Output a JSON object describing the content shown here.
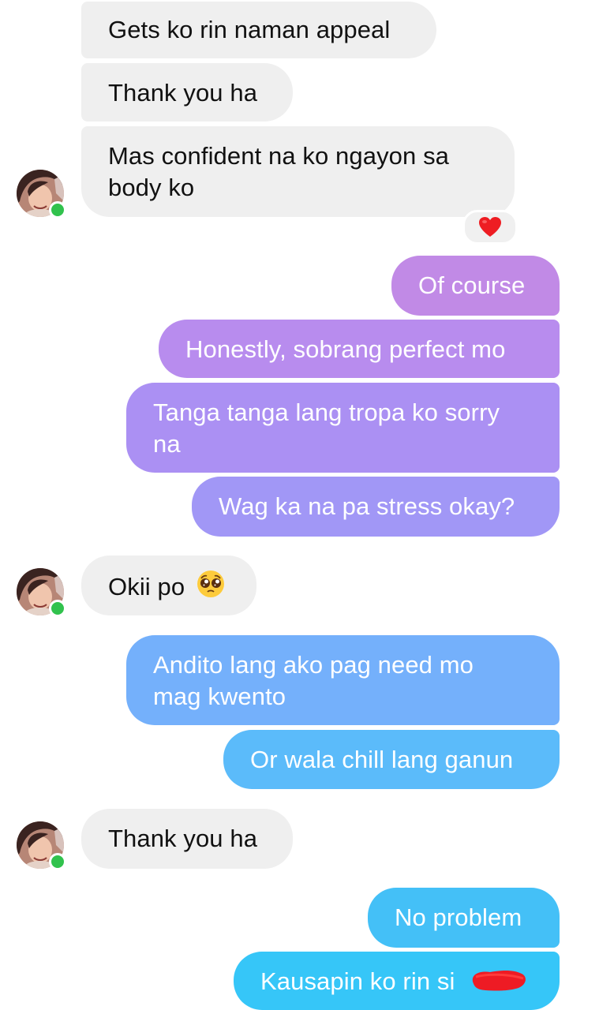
{
  "chat": {
    "messages": [
      {
        "from": "contact",
        "text": "Gets ko rin naman appeal"
      },
      {
        "from": "contact",
        "text": "Thank you ha"
      },
      {
        "from": "contact",
        "text": "Mas confident na ko ngayon sa body ko",
        "line1": "Mas confident na ko ngayon sa",
        "line2": "body ko",
        "reaction": "red-heart"
      },
      {
        "from": "me",
        "text": "Of course"
      },
      {
        "from": "me",
        "text": "Honestly, sobrang perfect mo"
      },
      {
        "from": "me",
        "text": "Tanga tanga lang tropa ko sorry na",
        "line1": "Tanga tanga lang tropa ko sorry",
        "line2": "na"
      },
      {
        "from": "me",
        "text": "Wag ka na pa stress okay?"
      },
      {
        "from": "contact",
        "text": "Okii po",
        "emoji": "pleading-face"
      },
      {
        "from": "me",
        "text": "Andito lang ako pag need mo mag kwento",
        "line1": "Andito lang ako pag need mo",
        "line2": "mag kwento"
      },
      {
        "from": "me",
        "text": "Or wala chill lang ganun"
      },
      {
        "from": "contact",
        "text": "Thank you ha"
      },
      {
        "from": "me",
        "text": "No problem"
      },
      {
        "from": "me",
        "text": "Kausapin ko rin si",
        "redacted": true
      }
    ]
  },
  "colors": {
    "incoming_bubble": "#efefef",
    "online_dot": "#31c24d",
    "gradient_top": "#c084e6",
    "gradient_mid": "#a58cf7",
    "gradient_blue": "#74b0fb",
    "gradient_bottom": "#3dc4f8",
    "redaction": "#ee1b24"
  }
}
